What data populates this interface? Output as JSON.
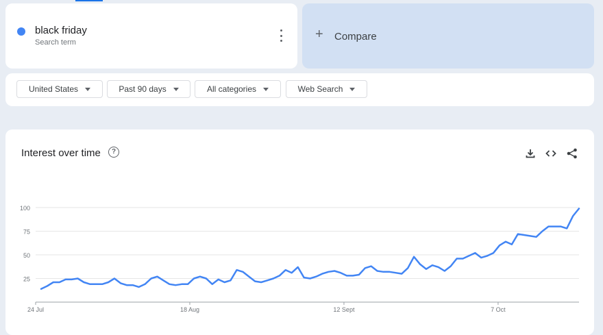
{
  "search_term": {
    "label": "black friday",
    "sublabel": "Search term",
    "color": "#4285f4"
  },
  "compare": {
    "plus": "+",
    "label": "Compare"
  },
  "filters": [
    {
      "label": "United States"
    },
    {
      "label": "Past 90 days"
    },
    {
      "label": "All categories"
    },
    {
      "label": "Web Search"
    }
  ],
  "chart_section": {
    "title": "Interest over time",
    "help_icon": "help-circle-icon",
    "tools": [
      "download-icon",
      "embed-code-icon",
      "share-icon"
    ]
  },
  "chart_data": {
    "type": "line",
    "title": "",
    "xlabel": "",
    "ylabel": "",
    "ylim": [
      0,
      100
    ],
    "yticks": [
      25,
      50,
      75,
      100
    ],
    "xticks": [
      "24 Jul",
      "18 Aug",
      "12 Sept",
      "7 Oct"
    ],
    "grid": true,
    "series": [
      {
        "color": "#4285f4",
        "values": [
          14,
          17,
          21,
          21,
          24,
          24,
          25,
          21,
          19,
          19,
          19,
          21,
          25,
          20,
          18,
          18,
          16,
          19,
          25,
          27,
          23,
          19,
          18,
          19,
          19,
          25,
          27,
          25,
          19,
          24,
          21,
          23,
          34,
          32,
          27,
          22,
          21,
          23,
          25,
          28,
          34,
          31,
          37,
          26,
          25,
          27,
          30,
          32,
          33,
          31,
          28,
          28,
          29,
          36,
          38,
          33,
          32,
          32,
          31,
          30,
          36,
          48,
          40,
          35,
          39,
          37,
          33,
          38,
          46,
          46,
          49,
          52,
          47,
          49,
          52,
          60,
          64,
          61,
          72,
          71,
          70,
          69,
          75,
          80,
          80,
          80,
          78,
          91,
          99
        ]
      }
    ]
  }
}
